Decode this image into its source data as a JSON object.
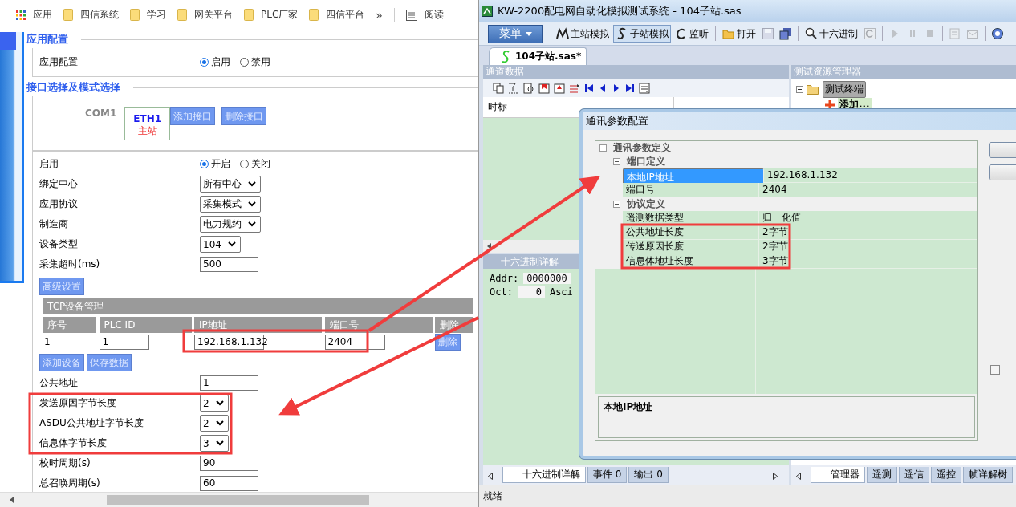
{
  "browser": {
    "bookmarks": [
      {
        "kind": "apps",
        "label": "应用"
      },
      {
        "kind": "folder",
        "label": "四信系统"
      },
      {
        "kind": "folder",
        "label": "学习"
      },
      {
        "kind": "folder",
        "label": "网关平台"
      },
      {
        "kind": "folder",
        "label": "PLC厂家"
      },
      {
        "kind": "folder",
        "label": "四信平台"
      }
    ],
    "overflow": "»",
    "reading_list": "阅读"
  },
  "config": {
    "app_section": {
      "title": "应用配置",
      "label": "应用配置",
      "options": [
        {
          "label": "启用",
          "selected": true
        },
        {
          "label": "禁用",
          "selected": false
        }
      ]
    },
    "interface_section": {
      "title": "接口选择及模式选择",
      "tabs": [
        {
          "label": "COM1",
          "selected": false
        },
        {
          "label": "ETH1",
          "role": "主站",
          "selected": true
        }
      ],
      "buttons": [
        "添加接口",
        "删除接口"
      ]
    },
    "rows": [
      {
        "kind": "radio",
        "label": "启用",
        "options": [
          {
            "label": "开启",
            "selected": true
          },
          {
            "label": "关闭",
            "selected": false
          }
        ]
      },
      {
        "kind": "select",
        "label": "绑定中心",
        "value": "所有中心"
      },
      {
        "kind": "select",
        "label": "应用协议",
        "value": "采集模式"
      },
      {
        "kind": "select",
        "label": "制造商",
        "value": "电力规约"
      },
      {
        "kind": "select",
        "label": "设备类型",
        "value": "104"
      },
      {
        "kind": "input",
        "label": "采集超时(ms)",
        "value": "500"
      }
    ],
    "advanced_button": "高级设置",
    "tcp_table": {
      "title": "TCP设备管理",
      "columns": [
        "序号",
        "PLC ID",
        "IP地址",
        "端口号",
        "删除"
      ],
      "rows": [
        {
          "index": "1",
          "plc_id": "1",
          "ip": "192.168.1.132",
          "port": "2404",
          "action": "删除"
        }
      ]
    },
    "table_buttons": [
      "添加设备",
      "保存数据"
    ],
    "rows_2": [
      {
        "kind": "input",
        "label": "公共地址",
        "value": "1"
      },
      {
        "kind": "select",
        "label": "发送原因字节长度",
        "value": "2"
      },
      {
        "kind": "select",
        "label": "ASDU公共地址字节长度",
        "value": "2"
      },
      {
        "kind": "select",
        "label": "信息体字节长度",
        "value": "3"
      },
      {
        "kind": "input",
        "label": "校时周期(s)",
        "value": "90"
      },
      {
        "kind": "input",
        "label": "总召唤周期(s)",
        "value": "60"
      }
    ]
  },
  "app": {
    "title": "KW-2200配电网自动化模拟测试系统 - 104子站.sas",
    "menu": "菜单",
    "toolbar": [
      {
        "kind": "text",
        "label": "主站模拟",
        "selected": false
      },
      {
        "kind": "text",
        "label": "子站模拟",
        "selected": true
      },
      {
        "kind": "text",
        "label": "监听",
        "selected": false
      },
      {
        "kind": "separator"
      },
      {
        "kind": "text",
        "label": "打开",
        "selected": false
      },
      {
        "kind": "icon",
        "disabled": true
      },
      {
        "kind": "icon",
        "disabled": false
      },
      {
        "kind": "separator"
      },
      {
        "kind": "text",
        "label": "十六进制",
        "selected": false
      },
      {
        "kind": "icon",
        "disabled": true
      },
      {
        "kind": "separator"
      },
      {
        "kind": "icon",
        "disabled": true
      },
      {
        "kind": "icon",
        "disabled": true
      },
      {
        "kind": "icon",
        "disabled": true
      },
      {
        "kind": "separator"
      },
      {
        "kind": "icon",
        "disabled": true
      },
      {
        "kind": "icon",
        "disabled": true
      },
      {
        "kind": "separator"
      },
      {
        "kind": "icon",
        "disabled": false
      }
    ],
    "document_tab": {
      "label": "104子站.sas*",
      "selected": true
    },
    "channel_panel": {
      "title": "通道数据",
      "columns": [
        "时标"
      ],
      "hex_title": "十六进制详解",
      "hex_lines": [
        {
          "label": "Addr:",
          "value": "0000000"
        },
        {
          "label": "Oct:",
          "value": "0",
          "extra": "Asci"
        }
      ],
      "tabs": [
        {
          "label": "十六进制详解",
          "selected": true
        },
        {
          "label": "事件 0",
          "selected": false
        },
        {
          "label": "输出 0",
          "selected": false
        }
      ]
    },
    "explorer_panel": {
      "title": "测试资源管理器",
      "tree": [
        {
          "label": "测试终端",
          "selected": true,
          "expanded": true,
          "children": [
            {
              "label": "添加...",
              "selected": false
            }
          ]
        }
      ],
      "tabs": [
        {
          "label": "管理器",
          "selected": true
        },
        {
          "label": "遥测",
          "selected": false
        },
        {
          "label": "遥信",
          "selected": false
        },
        {
          "label": "遥控",
          "selected": false
        },
        {
          "label": "帧详解树",
          "selected": false
        }
      ]
    },
    "status": "就绪",
    "dialog": {
      "title": "通讯参数配置",
      "root": {
        "label": "通讯参数定义",
        "expanded": true
      },
      "groups": [
        {
          "label": "端口定义",
          "expanded": true,
          "properties": [
            {
              "name": "本地IP地址",
              "value": "192.168.1.132",
              "selected": true
            },
            {
              "name": "端口号",
              "value": "2404",
              "selected": false
            }
          ]
        },
        {
          "label": "协议定义",
          "expanded": true,
          "properties": [
            {
              "name": "遥测数据类型",
              "value": "归一化值",
              "selected": false
            },
            {
              "name": "公共地址长度",
              "value": "2字节",
              "selected": false
            },
            {
              "name": "传送原因长度",
              "value": "2字节",
              "selected": false
            },
            {
              "name": "信息体地址长度",
              "value": "3字节",
              "selected": false
            }
          ]
        }
      ],
      "description": "本地IP地址",
      "checkbox": {
        "checked": false
      }
    }
  }
}
